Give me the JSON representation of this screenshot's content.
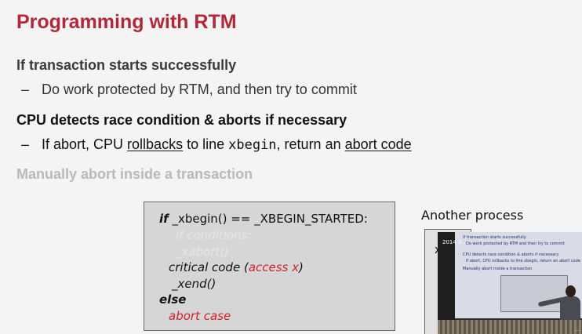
{
  "slide": {
    "title": "Programming with RTM",
    "bullets": [
      {
        "text": "If transaction starts successfully"
      },
      {
        "sub": "Do work protected by RTM, and then try to commit"
      },
      {
        "text": "CPU detects race condition & aborts if necessary"
      },
      {
        "sub_parts": [
          "If abort, CPU ",
          "rollbacks",
          " to line ",
          "xbegin",
          ", return an ",
          "abort code"
        ]
      },
      {
        "text": "Manually abort inside a transaction"
      }
    ],
    "dash": "–"
  },
  "code": {
    "line1_kw": "if",
    "line1_rest": " _xbegin() == _XBEGIN_STARTED:",
    "ghost1": "if conditions:",
    "ghost2": "_xabort()",
    "line4_a": "critical code (",
    "line4_red": "access x",
    "line4_b": ")",
    "line5": "_xend()",
    "line6_kw": "else",
    "line7_red": "abort case"
  },
  "another": {
    "label": "Another process",
    "fragment": "x"
  },
  "video": {
    "stamp": "2014 3 ...",
    "screen_lines": [
      "If transaction starts successfully",
      "Do work protected by RTM and then try to commit",
      "CPU detects race condition & aborts if necessary",
      "If abort, CPU rollbacks to line xbegin, return an abort code",
      "Manually abort inside a transaction"
    ],
    "logo": "..."
  },
  "colors": {
    "title": "#b0283a",
    "accent_red": "#d2202a",
    "slide_bg": "#f4f4f4",
    "code_bg": "#d6d6d6"
  }
}
